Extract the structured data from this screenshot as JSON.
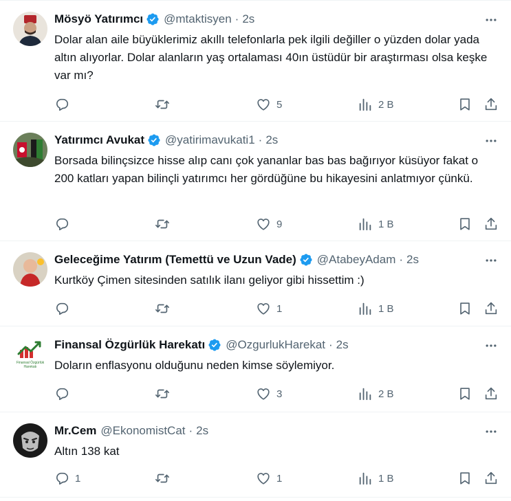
{
  "tweets": [
    {
      "name": "Mösyö Yatırımcı",
      "verified": true,
      "handle": "@mtaktisyen",
      "separator": "·",
      "time": "2s",
      "text": "Dolar alan aile büyüklerimiz akıllı telefonlarla pek ilgili değiller o yüzden dolar yada altın alıyorlar. Dolar alanların yaş ortalaması 40ın üstüdür bir araştırması olsa keşke var mı?",
      "replies": "",
      "retweets": "",
      "likes": "5",
      "views": "2 B",
      "avatar": "fez-portrait"
    },
    {
      "name": "Yatırımcı Avukat",
      "verified": true,
      "handle": "@yatirimavukati1",
      "separator": "·",
      "time": "2s",
      "text": "Borsada bilinçsizce hisse alıp canı çok yananlar bas bas bağırıyor küsüyor fakat o 200 katları yapan bilinçli yatırımcı her gördüğüne bu hikayesini anlatmıyor çünkü.",
      "replies": "",
      "retweets": "",
      "likes": "9",
      "views": "1 B",
      "avatar": "flags-photo"
    },
    {
      "name": "Geleceğime Yatırım (Temettü ve Uzun Vade)",
      "verified": true,
      "handle": "@AtabeyAdam",
      "separator": "·",
      "time": "2s",
      "text": "Kurtköy Çimen sitesinden satılık ilanı geliyor gibi hissettim :)",
      "replies": "",
      "retweets": "",
      "likes": "1",
      "views": "1 B",
      "avatar": "baby-photo"
    },
    {
      "name": "Finansal Özgürlük Harekatı",
      "verified": true,
      "handle": "@OzgurlukHarekat",
      "separator": "·",
      "time": "2s",
      "text": "Doların enflasyonu olduğunu neden kimse söylemiyor.",
      "replies": "",
      "retweets": "",
      "likes": "3",
      "views": "2 B",
      "avatar": "growth-logo",
      "avatar_text": "Finansal Özgürlük Harekatı"
    },
    {
      "name": "Mr.Cem",
      "verified": false,
      "handle": "@EkonomistCat",
      "separator": "·",
      "time": "2s",
      "text": "Altın 138 kat",
      "replies": "1",
      "retweets": "",
      "likes": "1",
      "views": "1 B",
      "avatar": "dark-portrait"
    }
  ],
  "colors": {
    "text": "#0f1419",
    "secondary": "#536471",
    "verified": "#1d9bf0",
    "divider": "#eff3f4"
  },
  "icons": [
    "reply-icon",
    "retweet-icon",
    "like-icon",
    "views-icon",
    "bookmark-icon",
    "share-icon",
    "more-icon",
    "verified-badge-icon"
  ]
}
